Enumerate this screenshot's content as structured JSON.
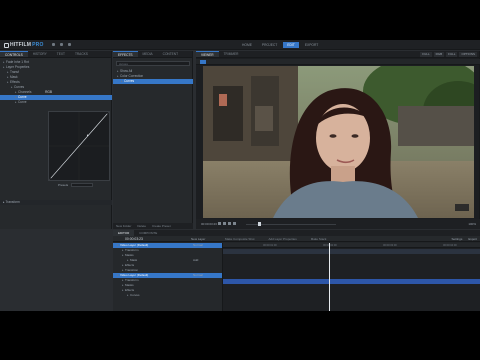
{
  "app": {
    "logo_text": "HITFILM",
    "logo_suffix": "PRO",
    "workspace_tabs": [
      "HOME",
      "PROJECT",
      "EDIT",
      "EXPORT"
    ],
    "active_workspace": "EDIT"
  },
  "controls_panel": {
    "tabs": [
      "CONTROLS",
      "HISTORY",
      "TEXT",
      "TRACKS"
    ],
    "items": [
      {
        "label": "Fade Inhe 1 Rnt",
        "indent": 0
      },
      {
        "label": "Layer Properties",
        "indent": 0
      },
      {
        "label": "Transf",
        "indent": 1
      },
      {
        "label": "Mask",
        "indent": 1
      },
      {
        "label": "Effects",
        "indent": 1
      },
      {
        "label": "Curves",
        "indent": 2
      },
      {
        "label": "Channels",
        "indent": 3,
        "value": "RGB"
      },
      {
        "label": "Curve",
        "indent": 3,
        "selected": true
      },
      {
        "label": "Curve",
        "indent": 3
      }
    ],
    "preset_label": "Presets",
    "footer_label": "Transform"
  },
  "effects_panel": {
    "tabs": [
      "EFFECTS",
      "MEDIA",
      "CONTENT"
    ],
    "search_placeholder": "curves",
    "items": [
      {
        "label": "Show All",
        "indent": 0
      },
      {
        "label": "Color Correction",
        "indent": 0
      },
      {
        "label": "Curves",
        "indent": 1,
        "selected": true
      }
    ],
    "footer": [
      "New Folder",
      "Delete",
      "Create Preset"
    ]
  },
  "viewer": {
    "tabs": [
      "VIEWER",
      "TRIMMER"
    ],
    "right_controls": [
      "FULL",
      "RGB",
      "FULL",
      "OPTIONS"
    ],
    "timecode": "00:00:03:23",
    "zoom": "100%"
  },
  "editor": {
    "tabs": [
      "EDITOR",
      "COMPOSITE"
    ],
    "timecode": "00:00:03:23",
    "new_layer": "New Layer",
    "timeline_labels": [
      "Make Composite Shot",
      "Add Layer Properties",
      "Make Stack"
    ],
    "right_controls": [
      "Settings",
      "Export"
    ],
    "ruler_ticks": [
      "00:00:01:00",
      "00:00:02:00",
      "00:00:03:00",
      "00:00:04:00"
    ],
    "layers": [
      {
        "label": "Video Layer (Default)",
        "indent": 0,
        "blend": "Normal",
        "head": true
      },
      {
        "label": "Transform",
        "indent": 1
      },
      {
        "label": "Masks",
        "indent": 1
      },
      {
        "label": "Mask",
        "indent": 2,
        "blend": "Add"
      },
      {
        "label": "Effects",
        "indent": 1
      },
      {
        "label": "Transition",
        "indent": 1
      },
      {
        "label": "Video Layer (Default)",
        "indent": 0,
        "blend": "Normal",
        "head": true
      },
      {
        "label": "Transform",
        "indent": 1
      },
      {
        "label": "Masks",
        "indent": 1
      },
      {
        "label": "Effects",
        "indent": 1
      },
      {
        "label": "Curves",
        "indent": 2
      }
    ],
    "playhead_time": "00:00:03:23"
  }
}
